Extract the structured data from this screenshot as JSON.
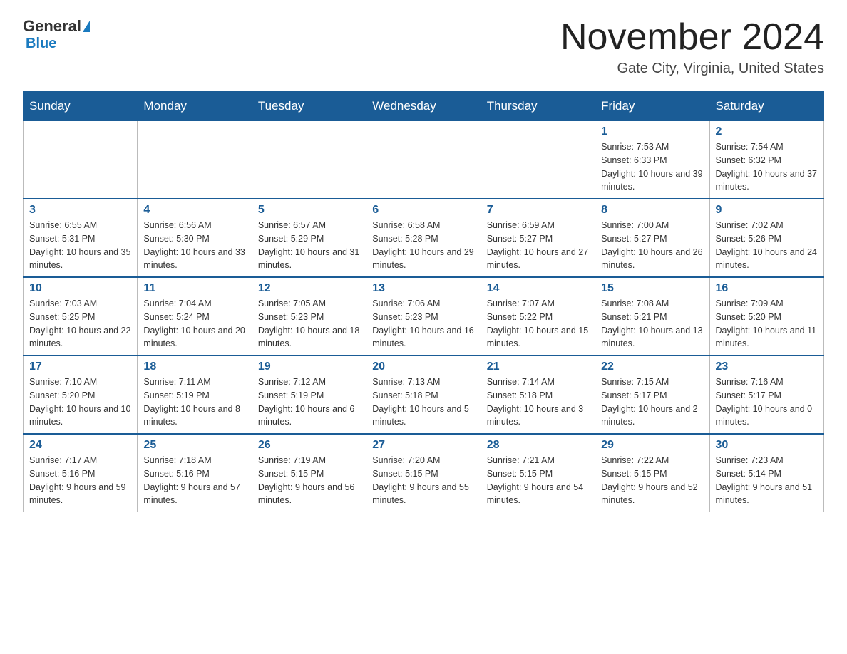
{
  "header": {
    "logo_general": "General",
    "logo_blue": "Blue",
    "month_title": "November 2024",
    "location": "Gate City, Virginia, United States"
  },
  "days_of_week": [
    "Sunday",
    "Monday",
    "Tuesday",
    "Wednesday",
    "Thursday",
    "Friday",
    "Saturday"
  ],
  "weeks": [
    [
      {
        "day": "",
        "sunrise": "",
        "sunset": "",
        "daylight": ""
      },
      {
        "day": "",
        "sunrise": "",
        "sunset": "",
        "daylight": ""
      },
      {
        "day": "",
        "sunrise": "",
        "sunset": "",
        "daylight": ""
      },
      {
        "day": "",
        "sunrise": "",
        "sunset": "",
        "daylight": ""
      },
      {
        "day": "",
        "sunrise": "",
        "sunset": "",
        "daylight": ""
      },
      {
        "day": "1",
        "sunrise": "Sunrise: 7:53 AM",
        "sunset": "Sunset: 6:33 PM",
        "daylight": "Daylight: 10 hours and 39 minutes."
      },
      {
        "day": "2",
        "sunrise": "Sunrise: 7:54 AM",
        "sunset": "Sunset: 6:32 PM",
        "daylight": "Daylight: 10 hours and 37 minutes."
      }
    ],
    [
      {
        "day": "3",
        "sunrise": "Sunrise: 6:55 AM",
        "sunset": "Sunset: 5:31 PM",
        "daylight": "Daylight: 10 hours and 35 minutes."
      },
      {
        "day": "4",
        "sunrise": "Sunrise: 6:56 AM",
        "sunset": "Sunset: 5:30 PM",
        "daylight": "Daylight: 10 hours and 33 minutes."
      },
      {
        "day": "5",
        "sunrise": "Sunrise: 6:57 AM",
        "sunset": "Sunset: 5:29 PM",
        "daylight": "Daylight: 10 hours and 31 minutes."
      },
      {
        "day": "6",
        "sunrise": "Sunrise: 6:58 AM",
        "sunset": "Sunset: 5:28 PM",
        "daylight": "Daylight: 10 hours and 29 minutes."
      },
      {
        "day": "7",
        "sunrise": "Sunrise: 6:59 AM",
        "sunset": "Sunset: 5:27 PM",
        "daylight": "Daylight: 10 hours and 27 minutes."
      },
      {
        "day": "8",
        "sunrise": "Sunrise: 7:00 AM",
        "sunset": "Sunset: 5:27 PM",
        "daylight": "Daylight: 10 hours and 26 minutes."
      },
      {
        "day": "9",
        "sunrise": "Sunrise: 7:02 AM",
        "sunset": "Sunset: 5:26 PM",
        "daylight": "Daylight: 10 hours and 24 minutes."
      }
    ],
    [
      {
        "day": "10",
        "sunrise": "Sunrise: 7:03 AM",
        "sunset": "Sunset: 5:25 PM",
        "daylight": "Daylight: 10 hours and 22 minutes."
      },
      {
        "day": "11",
        "sunrise": "Sunrise: 7:04 AM",
        "sunset": "Sunset: 5:24 PM",
        "daylight": "Daylight: 10 hours and 20 minutes."
      },
      {
        "day": "12",
        "sunrise": "Sunrise: 7:05 AM",
        "sunset": "Sunset: 5:23 PM",
        "daylight": "Daylight: 10 hours and 18 minutes."
      },
      {
        "day": "13",
        "sunrise": "Sunrise: 7:06 AM",
        "sunset": "Sunset: 5:23 PM",
        "daylight": "Daylight: 10 hours and 16 minutes."
      },
      {
        "day": "14",
        "sunrise": "Sunrise: 7:07 AM",
        "sunset": "Sunset: 5:22 PM",
        "daylight": "Daylight: 10 hours and 15 minutes."
      },
      {
        "day": "15",
        "sunrise": "Sunrise: 7:08 AM",
        "sunset": "Sunset: 5:21 PM",
        "daylight": "Daylight: 10 hours and 13 minutes."
      },
      {
        "day": "16",
        "sunrise": "Sunrise: 7:09 AM",
        "sunset": "Sunset: 5:20 PM",
        "daylight": "Daylight: 10 hours and 11 minutes."
      }
    ],
    [
      {
        "day": "17",
        "sunrise": "Sunrise: 7:10 AM",
        "sunset": "Sunset: 5:20 PM",
        "daylight": "Daylight: 10 hours and 10 minutes."
      },
      {
        "day": "18",
        "sunrise": "Sunrise: 7:11 AM",
        "sunset": "Sunset: 5:19 PM",
        "daylight": "Daylight: 10 hours and 8 minutes."
      },
      {
        "day": "19",
        "sunrise": "Sunrise: 7:12 AM",
        "sunset": "Sunset: 5:19 PM",
        "daylight": "Daylight: 10 hours and 6 minutes."
      },
      {
        "day": "20",
        "sunrise": "Sunrise: 7:13 AM",
        "sunset": "Sunset: 5:18 PM",
        "daylight": "Daylight: 10 hours and 5 minutes."
      },
      {
        "day": "21",
        "sunrise": "Sunrise: 7:14 AM",
        "sunset": "Sunset: 5:18 PM",
        "daylight": "Daylight: 10 hours and 3 minutes."
      },
      {
        "day": "22",
        "sunrise": "Sunrise: 7:15 AM",
        "sunset": "Sunset: 5:17 PM",
        "daylight": "Daylight: 10 hours and 2 minutes."
      },
      {
        "day": "23",
        "sunrise": "Sunrise: 7:16 AM",
        "sunset": "Sunset: 5:17 PM",
        "daylight": "Daylight: 10 hours and 0 minutes."
      }
    ],
    [
      {
        "day": "24",
        "sunrise": "Sunrise: 7:17 AM",
        "sunset": "Sunset: 5:16 PM",
        "daylight": "Daylight: 9 hours and 59 minutes."
      },
      {
        "day": "25",
        "sunrise": "Sunrise: 7:18 AM",
        "sunset": "Sunset: 5:16 PM",
        "daylight": "Daylight: 9 hours and 57 minutes."
      },
      {
        "day": "26",
        "sunrise": "Sunrise: 7:19 AM",
        "sunset": "Sunset: 5:15 PM",
        "daylight": "Daylight: 9 hours and 56 minutes."
      },
      {
        "day": "27",
        "sunrise": "Sunrise: 7:20 AM",
        "sunset": "Sunset: 5:15 PM",
        "daylight": "Daylight: 9 hours and 55 minutes."
      },
      {
        "day": "28",
        "sunrise": "Sunrise: 7:21 AM",
        "sunset": "Sunset: 5:15 PM",
        "daylight": "Daylight: 9 hours and 54 minutes."
      },
      {
        "day": "29",
        "sunrise": "Sunrise: 7:22 AM",
        "sunset": "Sunset: 5:15 PM",
        "daylight": "Daylight: 9 hours and 52 minutes."
      },
      {
        "day": "30",
        "sunrise": "Sunrise: 7:23 AM",
        "sunset": "Sunset: 5:14 PM",
        "daylight": "Daylight: 9 hours and 51 minutes."
      }
    ]
  ]
}
